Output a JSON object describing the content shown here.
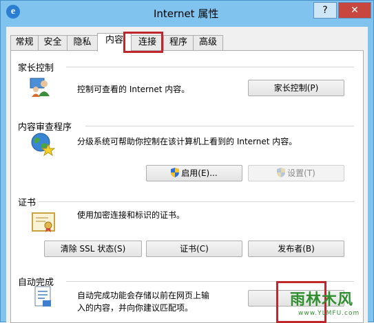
{
  "window": {
    "title": "Internet 属性",
    "help_label": "?",
    "close_label": "✕",
    "app_icon_letter": "e"
  },
  "tabs": [
    {
      "label": "常规",
      "active": false
    },
    {
      "label": "安全",
      "active": false
    },
    {
      "label": "隐私",
      "active": false
    },
    {
      "label": "内容",
      "active": true
    },
    {
      "label": "连接",
      "active": false
    },
    {
      "label": "程序",
      "active": false
    },
    {
      "label": "高级",
      "active": false
    }
  ],
  "parental": {
    "title": "家长控制",
    "description": "控制可查看的 Internet 内容。",
    "button": "家长控制(P)",
    "icon": "family-users-icon"
  },
  "advisor": {
    "title": "内容审查程序",
    "description": "分级系统可帮助你控制在该计算机上看到的 Internet 内容。",
    "enable_button": "启用(E)...",
    "settings_button": "设置(T)",
    "icon": "globe-star-icon"
  },
  "certificates": {
    "title": "证书",
    "description": "使用加密连接和标识的证书。",
    "clear_ssl_button": "清除 SSL 状态(S)",
    "certificates_button": "证书(C)",
    "publishers_button": "发布者(B)",
    "icon": "certificate-icon"
  },
  "autocomplete": {
    "title": "自动完成",
    "description_line1": "自动完成功能会存储以前在网页上输",
    "description_line2": "入的内容，并向你建议匹配项。",
    "icon": "form-document-icon"
  },
  "watermark": {
    "text": "雨林木风",
    "url": "www.YLMFU.com"
  },
  "colors": {
    "title_bar": "#7fc3ee",
    "close_button": "#c7463e",
    "highlight_box": "#c0262c",
    "watermark": "#2f8f2f"
  }
}
